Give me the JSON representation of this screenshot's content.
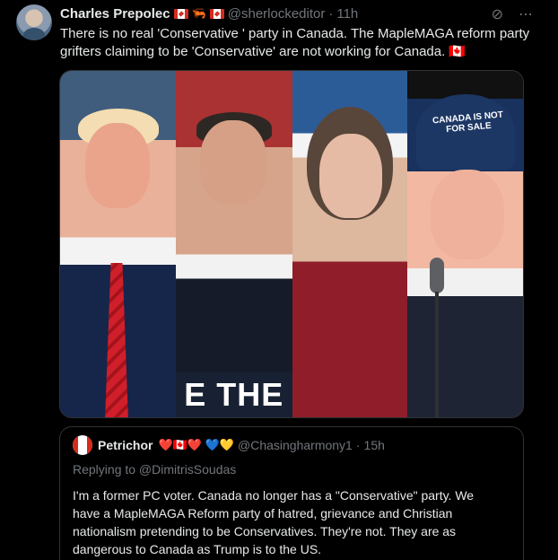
{
  "post": {
    "author_name": "Charles Prepolec",
    "author_badges": [
      "🇨🇦",
      "🦐",
      "🇨🇦"
    ],
    "handle": "@sherlockeditor",
    "separator": "·",
    "time": "11h",
    "text": "There is no real 'Conservative ' party in Canada. The MapleMAGA reform party grifters claiming to be 'Conservative' are not working for Canada. 🇨🇦",
    "actions": [
      "grok-icon",
      "more-icon"
    ]
  },
  "media": {
    "caption_text": "E THE",
    "cap_text": "CANADA IS NOT FOR SALE"
  },
  "quoted_post": {
    "author_name": "Petrichor",
    "author_emojis": "❤️🇨🇦❤️ 💙💛",
    "handle": "@Chasingharmony1",
    "separator": "·",
    "time": "15h",
    "replying_to": "Replying to @DimitrisSoudas",
    "text": "I'm a former PC voter. Canada no longer has a \"Conservative\" party. We have a MapleMAGA Reform party of hatred, grievance and Christian nationalism pretending to be Conservatives. They're not. They are as dangerous to Canada as Trump is to the US."
  }
}
